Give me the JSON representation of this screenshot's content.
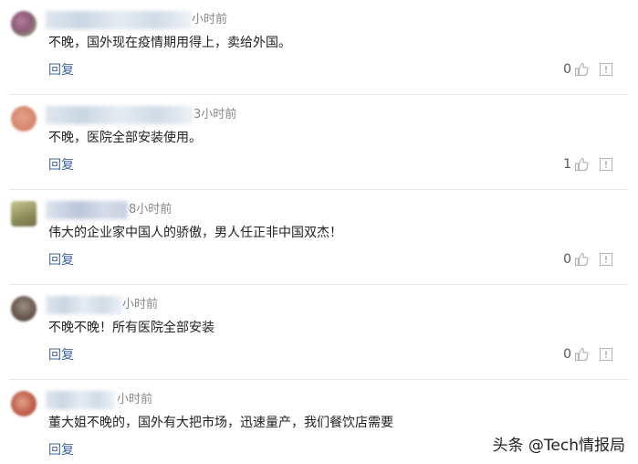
{
  "comments": [
    {
      "time": "小时前",
      "text": "不晚，国外现在疫情期用得上，卖给外国。",
      "reply_label": "回复",
      "likes": "0",
      "avatar_colors": [
        "#b6799a",
        "#7fae6b"
      ]
    },
    {
      "time": "3小时前",
      "text": "不晚，医院全部安装使用。",
      "reply_label": "回复",
      "likes": "1",
      "avatar_colors": [
        "#d98b73",
        "#f0b9a0"
      ]
    },
    {
      "time": "8小时前",
      "text": "伟大的企业家中国人的骄傲，男人任正非中国双杰！",
      "reply_label": "回复",
      "likes": "0",
      "avatar_colors": [
        "#8d8d5a",
        "#c9c793"
      ]
    },
    {
      "time": "小时前",
      "text": "不晚不晚！所有医院全部安装",
      "reply_label": "回复",
      "likes": "0",
      "avatar_colors": [
        "#6d5a50",
        "#9a8f86"
      ]
    },
    {
      "time": "小时前",
      "text": "董大姐不晚的，国外有大把市场，迅速量产，我们餐饮店需要",
      "reply_label": "回复",
      "likes": "",
      "avatar_colors": [
        "#c0604e",
        "#e3a38c"
      ]
    }
  ],
  "watermark": "头条 @Tech情报局",
  "colors": {
    "reply_link": "#406599",
    "time_text": "#888888",
    "icon_gray": "#b4b4b4"
  }
}
